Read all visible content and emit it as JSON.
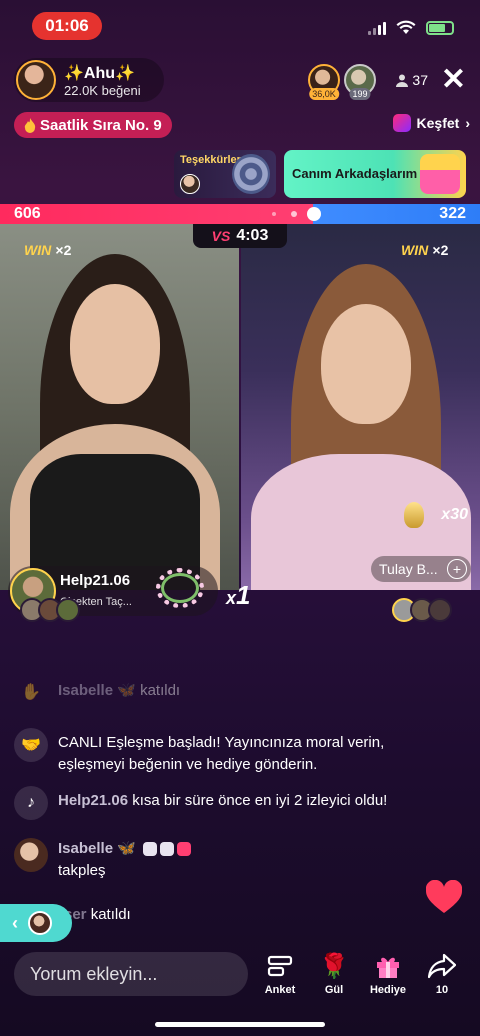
{
  "status_bar": {
    "time": "01:06"
  },
  "host": {
    "name": "✨Ahu✨",
    "likes": "22.0K beğeni"
  },
  "viewers": [
    {
      "badge": "36,0K"
    },
    {
      "badge": "199"
    }
  ],
  "viewer_count": "37",
  "ranking": {
    "label": "Saatlik Sıra No. 9"
  },
  "explore": {
    "label": "Keşfet"
  },
  "banners": {
    "thanks_title": "Teşekkürler",
    "friends_label": "Canım Arkadaşlarım"
  },
  "battle": {
    "left_score": "606",
    "right_score": "322",
    "left_share": 0.653,
    "timer": "4:03",
    "vs_label": "VS",
    "left_win": "WIN",
    "left_win_multiplier": "×2",
    "right_win": "WIN",
    "right_win_multiplier": "×2"
  },
  "right_panel": {
    "gift_multiplier": "x30",
    "guest_name": "Tulay B..."
  },
  "gift_notification": {
    "user": "Help21.06",
    "gift_text": "Çiçekten Taç...",
    "combo_prefix": "x",
    "combo_count": "1"
  },
  "chat": [
    {
      "user": "Isabelle 🦋",
      "text": "katıldı"
    },
    {
      "text": "CANLI Eşleşme başladı! Yayıncınıza moral verin, eşleşmeyi beğenin ve hediye gönderin."
    },
    {
      "user": "Help21.06",
      "text": "kısa bir süre önce en iyi 2 izleyici oldu!"
    },
    {
      "user": "Isabelle 🦋",
      "text": "takpleş"
    },
    {
      "user": "ser",
      "text": "katıldı"
    }
  ],
  "bottom_bar": {
    "comment_placeholder": "Yorum ekleyin...",
    "poll_label": "Anket",
    "rose_label": "Gül",
    "gift_label": "Hediye",
    "share_count": "10"
  },
  "colors": {
    "left_team": "#ff2a5e",
    "right_team": "#3f8cff",
    "accent_yellow": "#ffd34d",
    "time_pill": "#e5332f",
    "heart": "#ff3b5c"
  }
}
